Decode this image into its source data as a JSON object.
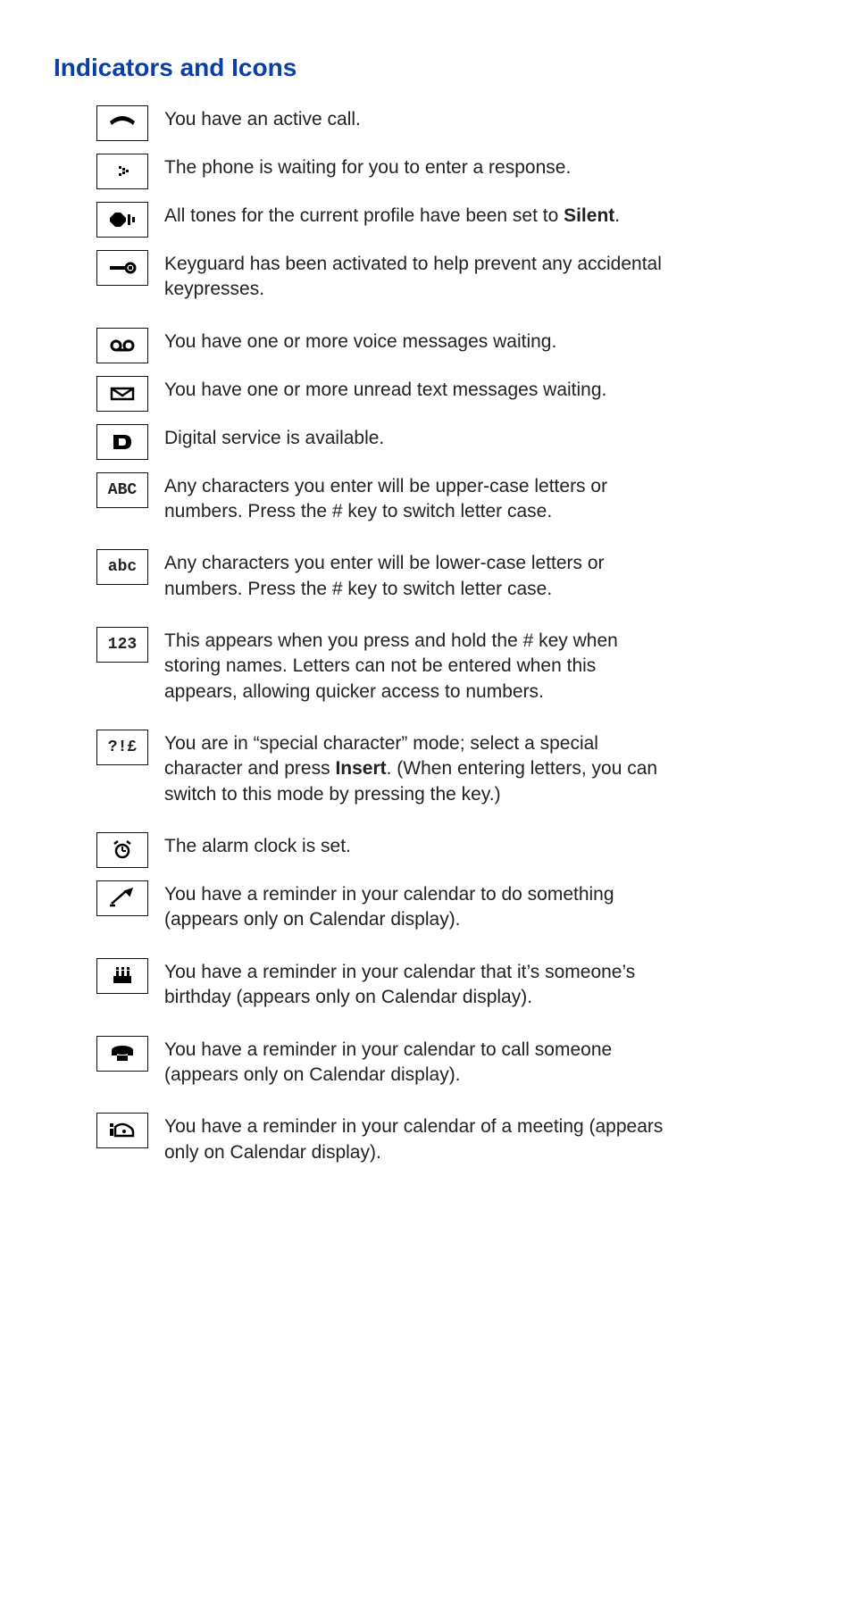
{
  "title": "Indicators and Icons",
  "items": [
    {
      "icon": "active-call-icon",
      "text": "You have an active call."
    },
    {
      "icon": "waiting-response-icon",
      "text": "The phone is waiting for you to enter a response."
    },
    {
      "icon": "silent-icon",
      "text_pre": "All tones for the current profile have been set to ",
      "text_bold": "Silent",
      "text_post": "."
    },
    {
      "icon": "keyguard-icon",
      "text": "Keyguard has been activated to help prevent any accidental keypresses."
    },
    {
      "icon": "voicemail-icon",
      "text": "You have one or more voice messages waiting.",
      "gap": true
    },
    {
      "icon": "unread-sms-icon",
      "text": "You have one or more unread text messages waiting."
    },
    {
      "icon": "digital-service-icon",
      "text": "Digital service is available."
    },
    {
      "icon": "uppercase-icon",
      "text": "Any characters you enter will be upper-case letters or numbers. Press the # key to switch letter case.",
      "label": "ABC"
    },
    {
      "icon": "lowercase-icon",
      "text": "Any characters you enter will be lower-case letters or numbers. Press the # key to switch letter case.",
      "label": "abc",
      "gap": true
    },
    {
      "icon": "numeric-icon",
      "text": "This appears when you press and hold the # key when storing names. Letters can not be entered when this appears, allowing quicker access to numbers.",
      "label": "123",
      "gap": true
    },
    {
      "icon": "special-char-icon",
      "text_pre": "You are in “special character” mode; select a special character and press ",
      "text_bold": "Insert",
      "text_post": ". (When entering letters, you can switch to this mode by pressing the   key.)",
      "label": "?!£",
      "gap": true
    },
    {
      "icon": "alarm-set-icon",
      "text": "The alarm clock is set.",
      "gap": true
    },
    {
      "icon": "reminder-todo-icon",
      "text": "You have a reminder in your calendar to do something (appears only on Calendar display)."
    },
    {
      "icon": "reminder-birthday-icon",
      "text": "You have a reminder in your calendar that it’s someone’s birthday (appears only on Calendar display).",
      "gap": true
    },
    {
      "icon": "reminder-call-icon",
      "text": "You have a reminder in your calendar to call someone (appears only on Calendar display).",
      "gap": true
    },
    {
      "icon": "reminder-meeting-icon",
      "text": "You have a reminder in your calendar of a meeting (appears only on Calendar display).",
      "gap": true
    }
  ]
}
